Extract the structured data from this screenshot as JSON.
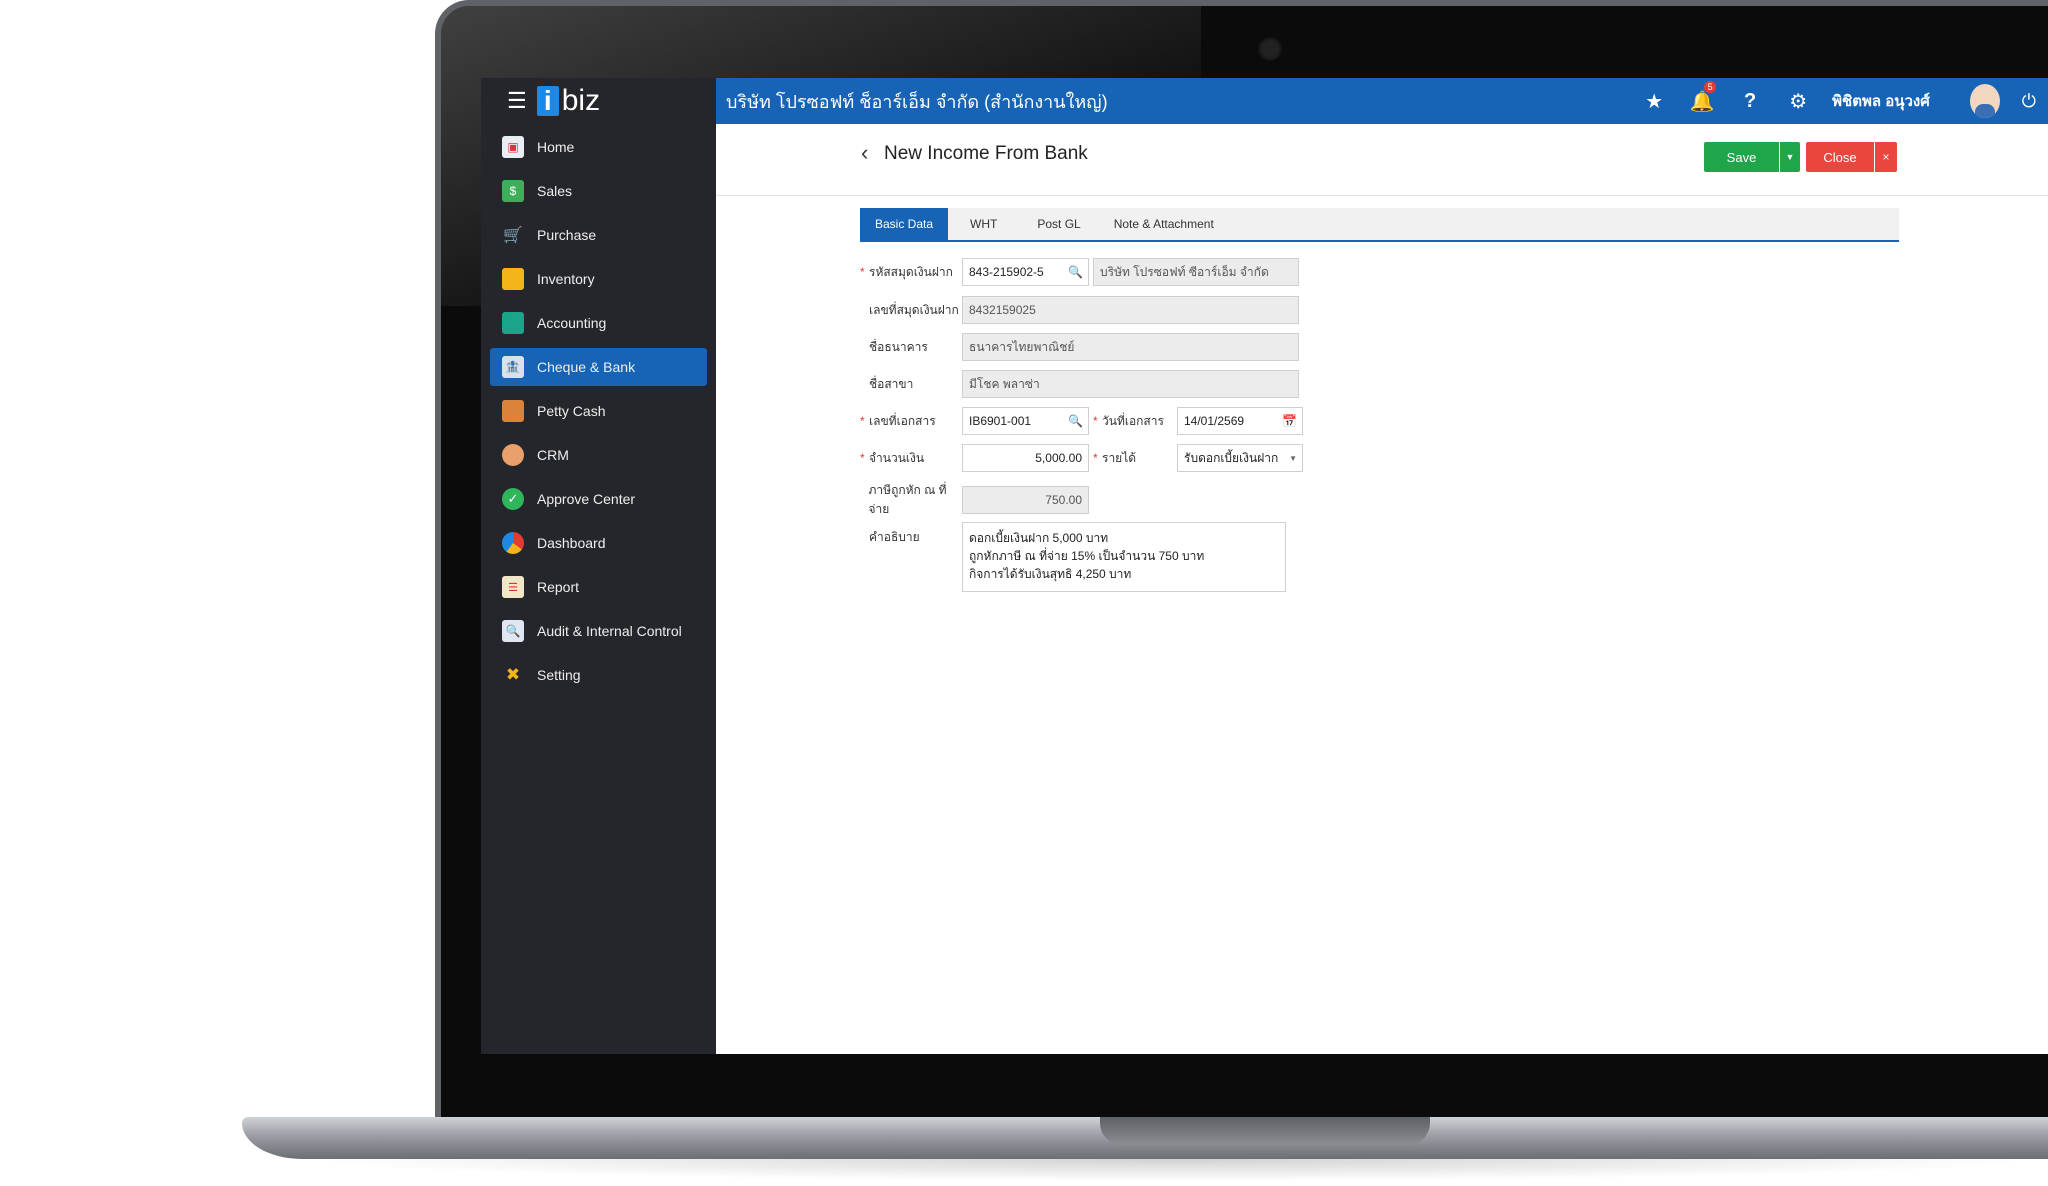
{
  "sidebar": {
    "logo_i": "i",
    "logo_rest": "biz",
    "items": [
      {
        "label": "Home",
        "icon": "home-icon"
      },
      {
        "label": "Sales",
        "icon": "money-icon"
      },
      {
        "label": "Purchase",
        "icon": "cart-icon"
      },
      {
        "label": "Inventory",
        "icon": "box-icon"
      },
      {
        "label": "Accounting",
        "icon": "book-icon"
      },
      {
        "label": "Cheque & Bank",
        "icon": "bank-icon",
        "active": true
      },
      {
        "label": "Petty Cash",
        "icon": "briefcase-icon"
      },
      {
        "label": "CRM",
        "icon": "crm-icon"
      },
      {
        "label": "Approve Center",
        "icon": "check-icon"
      },
      {
        "label": "Dashboard",
        "icon": "pie-chart-icon"
      },
      {
        "label": "Report",
        "icon": "report-icon"
      },
      {
        "label": "Audit & Internal Control",
        "icon": "audit-icon"
      },
      {
        "label": "Setting",
        "icon": "tools-icon"
      }
    ]
  },
  "topbar": {
    "company": "บริษัท โปรซอฟท์ ช็อาร์เอ็ม จำกัด (สำนักงานใหญ่)",
    "notification_count": "5",
    "user_name": "พิชิตพล อนุวงศ์"
  },
  "page": {
    "title": "New Income From Bank",
    "save_label": "Save",
    "close_label": "Close",
    "close_x": "×"
  },
  "tabs": [
    "Basic Data",
    "WHT",
    "Post GL",
    "Note & Attachment"
  ],
  "form": {
    "account_code_label": "รหัสสมุดเงินฝาก",
    "account_code_value": "843-215902-5",
    "account_name_value": "บริษัท โปรซอฟท์ ซีอาร์เอ็ม จำกัด",
    "account_no_label": "เลขที่สมุดเงินฝาก",
    "account_no_value": "8432159025",
    "bank_name_label": "ชื่อธนาคาร",
    "bank_name_value": "ธนาคารไทยพาณิชย์",
    "branch_label": "ชื่อสาขา",
    "branch_value": "มีโชค พลาซ่า",
    "doc_no_label": "เลขที่เอกสาร",
    "doc_no_value": "IB6901-001",
    "doc_date_label": "วันที่เอกสาร",
    "doc_date_value": "14/01/2569",
    "amount_label": "จำนวนเงิน",
    "amount_value": "5,000.00",
    "income_label": "รายได้",
    "income_value": "รับดอกเบี้ยเงินฝาก",
    "wht_label": "ภาษีถูกหัก ณ ที่จ่าย",
    "wht_value": "750.00",
    "desc_label": "คำอธิบาย",
    "desc_lines": [
      "ดอกเบี้ยเงินฝาก 5,000 บาท",
      "ถูกหักภาษี ณ ที่จ่าย 15% เป็นจำนวน 750 บาท",
      "กิจการได้รับเงินสุทธิ 4,250 บาท"
    ]
  },
  "colors": {
    "brand_blue": "#1763b6",
    "sidebar_bg": "#25262b",
    "save_green": "#1fa64b",
    "close_red": "#e9463f"
  }
}
